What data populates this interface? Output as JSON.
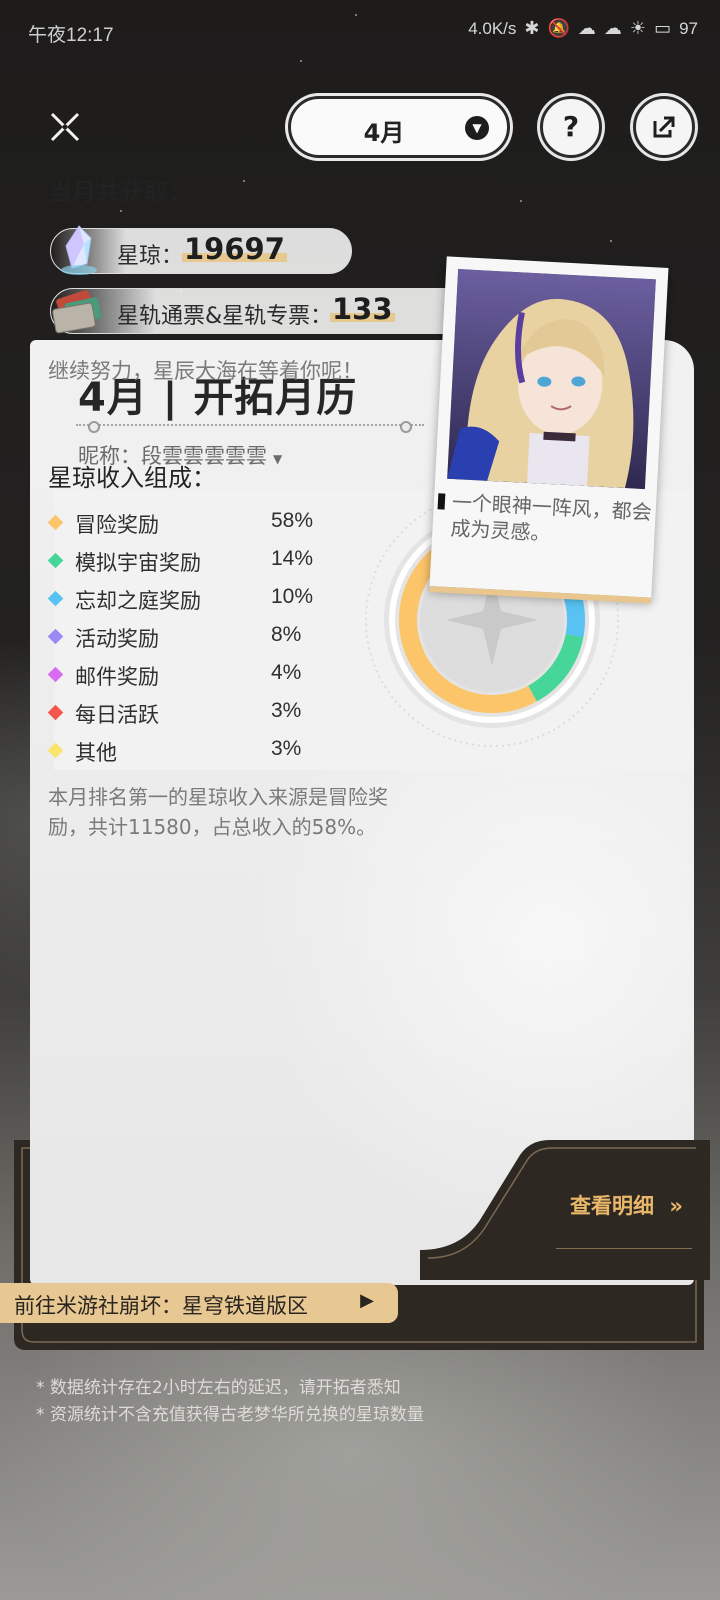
{
  "status_bar": {
    "time": "午夜12:17",
    "network_speed": "4.0K/s",
    "battery": "97"
  },
  "header": {
    "close_icon": "close-x-icon",
    "month_selector": "4月",
    "help_label": "?",
    "share_icon": "share-export-icon"
  },
  "card": {
    "title_month": "4月",
    "title_name": "开拓月历",
    "nickname": "昵称：段雲雲雲雲雲",
    "quote": "一个眼神一阵风，都会成为灵感。",
    "earned_header": "当月共获取：",
    "stellar_jade_label": "星琼：",
    "stellar_jade_value": "19697",
    "pass_label": "星轨通票&星轨专票：",
    "pass_value": "133",
    "encouragement": "继续努力，星辰大海在等着你呢！",
    "composition_header": "星琼收入组成：",
    "summary": "本月排名第一的星琼收入来源是冒险奖励，共计11580，占总收入的58%。",
    "details_link": "查看明细",
    "details_arrow": "»",
    "forum_link": "前往米游社崩坏：星穹铁道版区",
    "forum_arrow": "▶"
  },
  "chart_data": {
    "type": "pie",
    "title": "",
    "categories": [
      "冒险奖励",
      "模拟宇宙奖励",
      "忘却之庭奖励",
      "活动奖励",
      "邮件奖励",
      "每日活跃",
      "其他"
    ],
    "values": [
      58,
      14,
      10,
      8,
      4,
      3,
      3
    ],
    "labels": [
      "58%",
      "14%",
      "10%",
      "8%",
      "4%",
      "3%",
      "3%"
    ],
    "colors": [
      "#fcc56a",
      "#46d69a",
      "#58c3f3",
      "#9b8af5",
      "#d86bf2",
      "#f2564d",
      "#fbe46c"
    ],
    "legend_position": "left"
  },
  "footnotes": [
    "* 数据统计存在2小时左右的延迟，请开拓者悉知",
    "* 资源统计不含充值获得古老梦华所兑换的星琼数量"
  ]
}
